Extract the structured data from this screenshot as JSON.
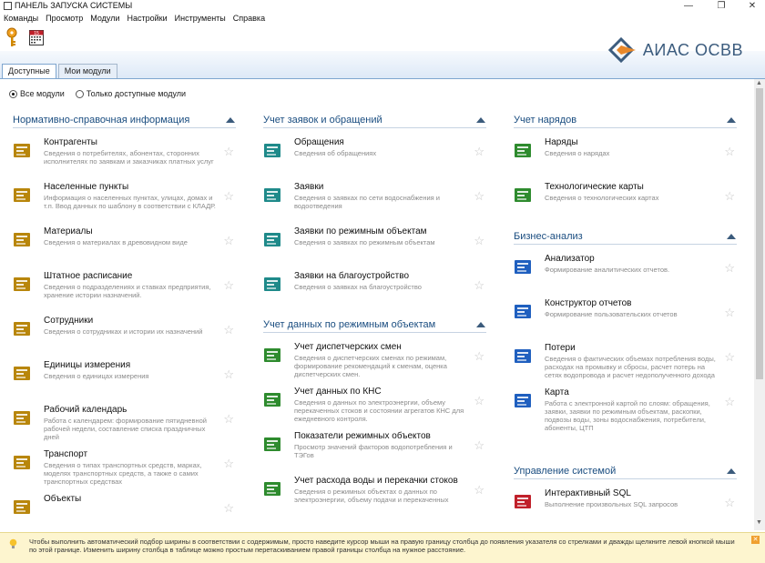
{
  "window": {
    "title": "ПАНЕЛЬ ЗАПУСКА СИСТЕМЫ",
    "minimize": "—",
    "restore": "❐",
    "close": "✕"
  },
  "menu": [
    "Команды",
    "Просмотр",
    "Модули",
    "Настройки",
    "Инструменты",
    "Справка"
  ],
  "toolbar": {
    "icons": [
      "key-icon",
      "calendar-icon"
    ],
    "calendar_number": "15"
  },
  "brand": {
    "name": "АИАС ОСВВ",
    "accent": "#3c5c7e"
  },
  "tabs": [
    {
      "label": "Доступные",
      "active": true
    },
    {
      "label": "Мои модули",
      "active": false
    }
  ],
  "filters": [
    {
      "label": "Все модули",
      "selected": true
    },
    {
      "label": "Только доступные модули",
      "selected": false
    }
  ],
  "columns": [
    {
      "sections": [
        {
          "title": "Нормативно-справочная информация",
          "color": "#b8860b",
          "modules": [
            {
              "title": "Контрагенты",
              "desc": "Сведения о потребителях, абонентах, сторонних исполнителях по заявкам и заказчиках платных услуг",
              "icon": "handshake-icon"
            },
            {
              "title": "Населенные пункты",
              "desc": "Информация о населенных пунктах, улицах, домах и т.п. Ввод данных по шаблону в соответствии с КЛАДР.",
              "icon": "building-icon"
            },
            {
              "title": "Материалы",
              "desc": "Сведения о материалах в древовидном виде",
              "icon": "boxes-icon"
            },
            {
              "title": "Штатное расписание",
              "desc": "Сведения о подразделениях и ставках предприятия, хранение истории назначений.",
              "icon": "staff-icon"
            },
            {
              "title": "Сотрудники",
              "desc": "Сведения о сотрудниках и истории их назначений",
              "icon": "people-icon"
            },
            {
              "title": "Единицы измерения",
              "desc": "Сведения о единицах измерения",
              "icon": "m2-icon"
            },
            {
              "title": "Рабочий календарь",
              "desc": "Работа с календарем: формирование пятидневной рабочей недели, составление списка праздничных дней",
              "icon": "calendar-clock-icon"
            },
            {
              "title": "Транспорт",
              "desc": "Сведения о типах транспортных средств, марках, моделях транспортных средств, а также о самих транспортных средствах",
              "icon": "truck-icon"
            },
            {
              "title": "Объекты",
              "desc": "",
              "icon": "objects-icon"
            }
          ]
        }
      ]
    },
    {
      "sections": [
        {
          "title": "Учет заявок и обращений",
          "color": "#1f8a8a",
          "modules": [
            {
              "title": "Обращения",
              "desc": "Сведения об обращениях",
              "icon": "appeals-icon"
            },
            {
              "title": "Заявки",
              "desc": "Сведения о заявках по сети водоснабжения и водоотведения",
              "icon": "requests-icon"
            },
            {
              "title": "Заявки по режимным объектам",
              "desc": "Сведения о заявках по режимным объектам",
              "icon": "regime-requests-icon"
            },
            {
              "title": "Заявки на благоустройство",
              "desc": "Сведения о заявках на благоустройство",
              "icon": "improvement-icon"
            }
          ]
        },
        {
          "title": "Учет данных по режимным объектам",
          "color": "#2e8b2e",
          "modules": [
            {
              "title": "Учет диспетчерских смен",
              "desc": "Сведения о диспетчерских сменах по режимам, формирование рекомендаций к сменам, оценка диспетчерских смен.",
              "icon": "shifts-icon"
            },
            {
              "title": "Учет данных по КНС",
              "desc": "Сведения о данных по электроэнергии, объему перекаченных стоков и состоянии агрегатов КНС для ежедневного контроля.",
              "icon": "kns-icon"
            },
            {
              "title": "Показатели режимных объектов",
              "desc": "Просмотр значений факторов водопотребления и ТЭГов",
              "icon": "gauge-icon"
            },
            {
              "title": "Учет расхода воды и перекачки стоков",
              "desc": "Сведения о режимных объектах о данных по электроэнергии, объему подачи и перекаченных",
              "icon": "water-icon"
            }
          ]
        }
      ]
    },
    {
      "sections": [
        {
          "title": "Учет нарядов",
          "color": "#2e8b2e",
          "modules": [
            {
              "title": "Наряды",
              "desc": "Сведения о нарядах",
              "icon": "orders-icon"
            },
            {
              "title": "Технологические карты",
              "desc": "Сведения о технологических картах",
              "icon": "techcards-icon"
            }
          ]
        },
        {
          "title": "Бизнес-анализ",
          "color": "#1f5fbf",
          "modules": [
            {
              "title": "Анализатор",
              "desc": "Формирование аналитических отчетов.",
              "icon": "bar-chart-icon"
            },
            {
              "title": "Конструктор отчетов",
              "desc": "Формирование пользовательских отчетов",
              "icon": "report-builder-icon"
            },
            {
              "title": "Потери",
              "desc": "Сведения о фактических объемах потребления воды, расходах на промывку и сбросы, расчет потерь на сетях водопровода и расчет недополученного дохода",
              "icon": "losses-icon"
            },
            {
              "title": "Карта",
              "desc": "Работа с электронной картой по слоям: обращения, заявки, заявки по режимным объектам, раскопки, подвозы воды, зоны водоснабжения, потребители, абоненты, ЦТП",
              "icon": "map-icon"
            }
          ]
        },
        {
          "title": "Управление системой",
          "color": "#c0202a",
          "modules": [
            {
              "title": "Интерактивный SQL",
              "desc": "Выполнение произвольных SQL запросов",
              "icon": "sql-icon"
            }
          ]
        }
      ]
    }
  ],
  "hint": "Чтобы выполнить автоматический подбор ширины в соответствии с содержимым, просто наведите курсор мыши на правую границу столбца до появления указателя со стрелками и дважды щелкните левой кнопкой мыши по этой границе. Изменить ширину столбца в таблице можно простым перетаскиванием правой границы столбца на нужное расстояние."
}
